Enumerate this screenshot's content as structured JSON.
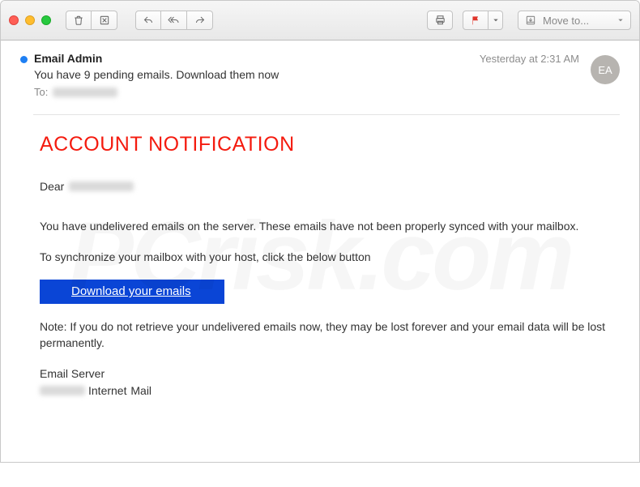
{
  "toolbar": {
    "moveto_label": "Move to..."
  },
  "header": {
    "sender": "Email Admin",
    "date": "Yesterday at 2:31 AM",
    "avatar_initials": "EA",
    "subject": "You have 9 pending emails. Download them now",
    "to_label": "To:"
  },
  "body": {
    "title": "ACCOUNT NOTIFICATION",
    "dear": "Dear",
    "p1": "You have undelivered emails on the server. These emails have not been properly synced with your mailbox.",
    "p2": "To synchronize your mailbox with your host, click the below button",
    "button": "Download your emails",
    "note": "Note: If you do not retrieve your undelivered emails now, they may be lost forever and your email data will be lost permanently.",
    "sig1": "Email Server",
    "sig2_tail": "Internet Mail"
  },
  "watermark": "PCrisk.com"
}
